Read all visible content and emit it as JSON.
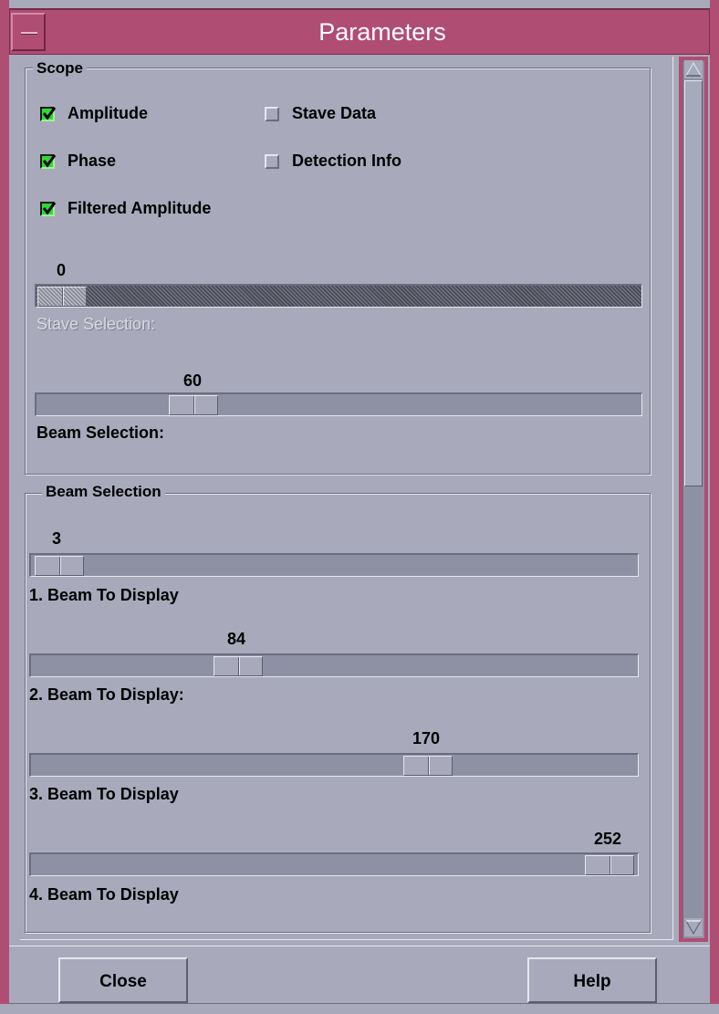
{
  "window": {
    "title": "Parameters"
  },
  "scope": {
    "legend": "Scope",
    "checkboxes": [
      {
        "label": "Amplitude",
        "checked": true
      },
      {
        "label": "Phase",
        "checked": true
      },
      {
        "label": "Filtered Amplitude",
        "checked": true
      },
      {
        "label": "Stave Data",
        "checked": false
      },
      {
        "label": "Detection Info",
        "checked": false
      }
    ],
    "stave_slider": {
      "value": "0",
      "label": "Stave Selection:",
      "enabled": false
    },
    "beam_slider": {
      "value": "60",
      "label": "Beam Selection:",
      "enabled": true,
      "fraction": 0.24
    }
  },
  "beam_selection": {
    "legend": "Beam Selection",
    "sliders": [
      {
        "value": "3",
        "label": "1. Beam To Display",
        "fraction": 0.01
      },
      {
        "value": "84",
        "label": "2. Beam To Display:",
        "fraction": 0.33
      },
      {
        "value": "170",
        "label": "3. Beam To Display",
        "fraction": 0.66
      },
      {
        "value": "252",
        "label": "4. Beam To Display",
        "fraction": 0.99
      }
    ]
  },
  "buttons": {
    "close": "Close",
    "help": "Help"
  },
  "colors": {
    "title_bar": "#b04d73",
    "background": "#a8aabb",
    "checkbox_on": "#2fdc2f"
  }
}
